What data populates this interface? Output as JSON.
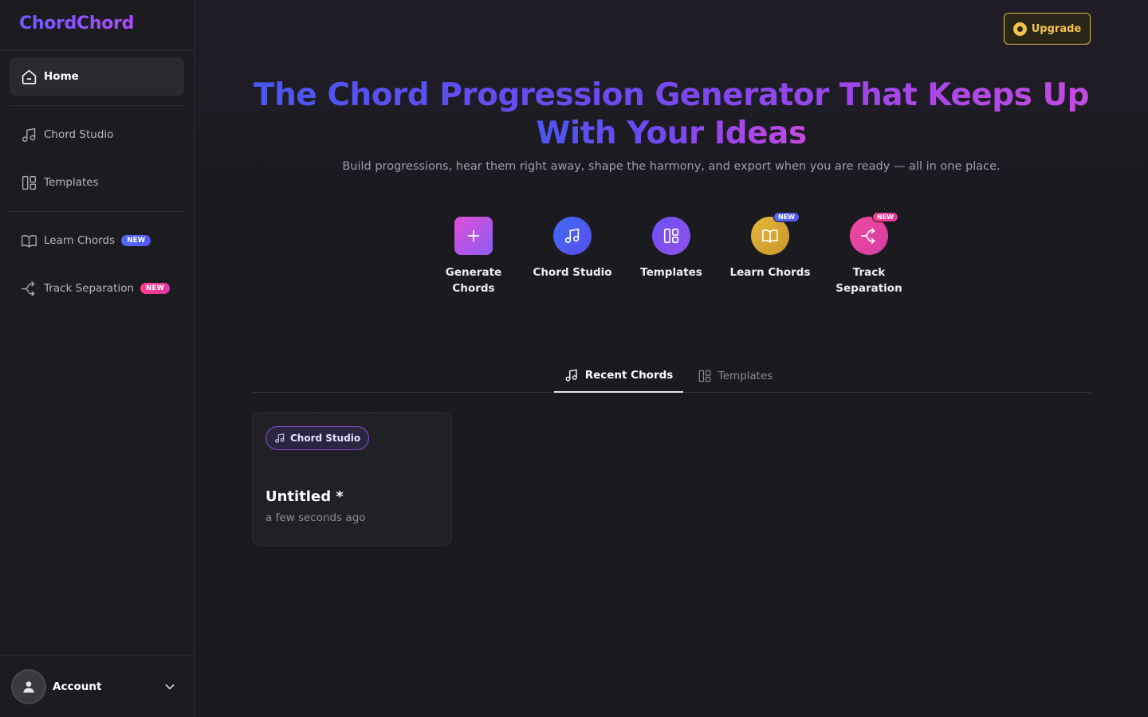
{
  "sidebar": {
    "logo": "ChordChord",
    "items": [
      {
        "label": "Home",
        "icon": "home-icon",
        "active": true
      },
      {
        "label": "Chord Studio",
        "icon": "music-note-icon"
      },
      {
        "label": "Templates",
        "icon": "layout-icon"
      },
      {
        "label": "Learn Chords",
        "icon": "book-icon",
        "badge": "NEW"
      },
      {
        "label": "Track Separation",
        "icon": "split-icon",
        "badge": "NEW"
      }
    ],
    "account_label": "Account"
  },
  "header": {
    "upgrade_label": "Upgrade"
  },
  "hero": {
    "title_line1": "The Chord Progression Generator That Keeps Up",
    "title_line2": "With Your Ideas",
    "subtitle": "Build progressions, hear them right away, shape the harmony, and export when you are ready — all in one place."
  },
  "actions": [
    {
      "label": "Generate Chords",
      "icon": "plus-icon",
      "color": "#c84be0"
    },
    {
      "label": "Chord Studio",
      "icon": "music-note-icon",
      "color": "#4f6af2"
    },
    {
      "label": "Templates",
      "icon": "layout-icon",
      "color": "#7a52f0"
    },
    {
      "label": "Learn Chords",
      "icon": "book-icon",
      "color": "#e0b030",
      "badge": "NEW"
    },
    {
      "label": "Track Separation",
      "icon": "split-icon",
      "color": "#ec4aa0",
      "badge": "NEW"
    }
  ],
  "tabs": [
    {
      "label": "Recent Chords",
      "active": true
    },
    {
      "label": "Templates",
      "active": false
    }
  ],
  "recent": [
    {
      "badge": "Chord Studio",
      "title": "Untitled *",
      "time": "a few seconds ago"
    }
  ],
  "colors": {
    "accent_purple": "#6f49f0",
    "upgrade_gold": "#f4c34d",
    "new_blue": "#4d6cff",
    "new_pink": "#ff3d8e"
  }
}
